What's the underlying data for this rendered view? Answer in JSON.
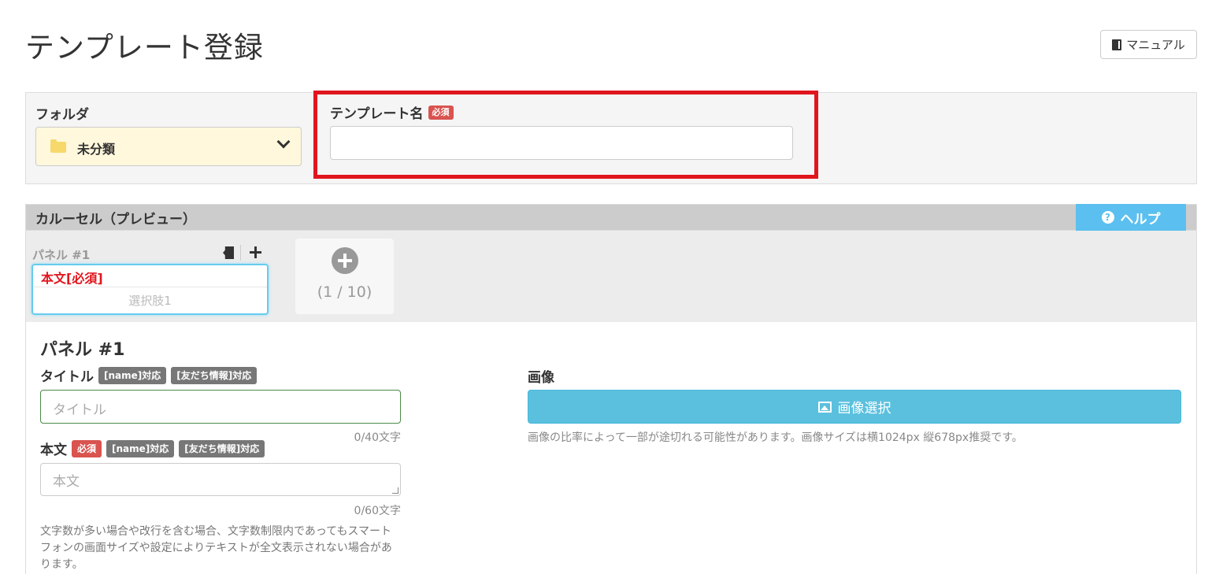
{
  "header": {
    "title": "テンプレート登録",
    "manual_label": "マニュアル"
  },
  "folder": {
    "label": "フォルダ",
    "selected": "未分類"
  },
  "template_name": {
    "label": "テンプレート名",
    "required_badge": "必須",
    "value": ""
  },
  "carousel": {
    "title": "カルーセル（プレビュー）",
    "help_label": "ヘルプ",
    "panel_tab_label": "パネル #1",
    "card_body": "本文[必須]",
    "card_choice": "選択肢1",
    "add_count": "(1 / 10)"
  },
  "panel": {
    "heading": "パネル #1",
    "title_label": "タイトル",
    "title_badges": [
      "[name]対応",
      "[友だち情報]対応"
    ],
    "title_placeholder": "タイトル",
    "title_counter": "0/40文字",
    "body_label": "本文",
    "body_required": "必須",
    "body_badges": [
      "[name]対応",
      "[友だち情報]対応"
    ],
    "body_placeholder": "本文",
    "body_counter": "0/60文字",
    "note": "文字数が多い場合や改行を含む場合、文字数制限内であってもスマートフォンの画面サイズや設定によりテキストが全文表示されない場合があります。",
    "image_label": "画像",
    "image_button": "画像選択",
    "image_note": "画像の比率によって一部が途切れる可能性があります。画像サイズは横1024px 縦678px推奨です。"
  }
}
